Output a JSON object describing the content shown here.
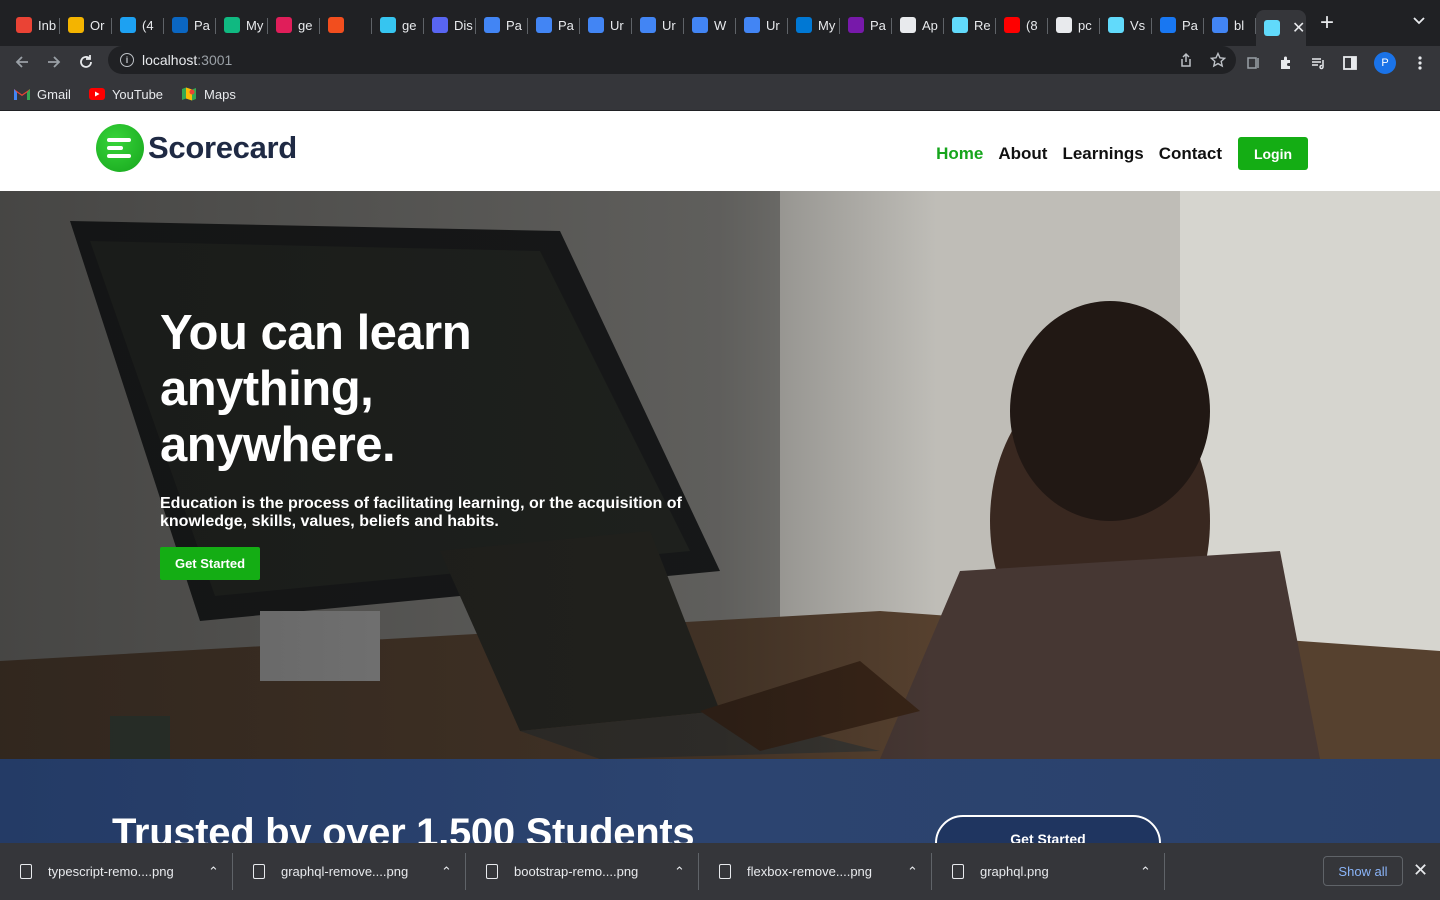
{
  "browser": {
    "tabs": [
      {
        "label": "Inb",
        "icon": "gmail-icon",
        "color": "#ea4335"
      },
      {
        "label": "Or",
        "icon": "pinwheel-icon",
        "color": "#f4b400"
      },
      {
        "label": "(4",
        "icon": "twitter-icon",
        "color": "#1da1f2"
      },
      {
        "label": "Pa",
        "icon": "linkedin-icon",
        "color": "#0a66c2"
      },
      {
        "label": "My",
        "icon": "globe-icon",
        "color": "#10b981"
      },
      {
        "label": "ge",
        "icon": "slack-icon",
        "color": "#e01e5a"
      },
      {
        "label": "",
        "icon": "figma-icon",
        "color": "#f24e1e"
      },
      {
        "label": "ge",
        "icon": "slack-icon",
        "color": "#36c5f0"
      },
      {
        "label": "Dis",
        "icon": "discord-icon",
        "color": "#5865f2"
      },
      {
        "label": "Pa",
        "icon": "docs-icon",
        "color": "#4285f4"
      },
      {
        "label": "Pa",
        "icon": "docs-icon",
        "color": "#4285f4"
      },
      {
        "label": "Ur",
        "icon": "docs-icon",
        "color": "#4285f4"
      },
      {
        "label": "Ur",
        "icon": "docs-icon",
        "color": "#4285f4"
      },
      {
        "label": "W",
        "icon": "docs-icon",
        "color": "#4285f4"
      },
      {
        "label": "Ur",
        "icon": "docs-icon",
        "color": "#4285f4"
      },
      {
        "label": "My",
        "icon": "azure-devops-icon",
        "color": "#0078d4"
      },
      {
        "label": "Pa",
        "icon": "onenote-icon",
        "color": "#7719aa"
      },
      {
        "label": "Ap",
        "icon": "zeplin-icon",
        "color": "#e8eaed"
      },
      {
        "label": "Re",
        "icon": "react-icon",
        "color": "#61dafb"
      },
      {
        "label": "(8",
        "icon": "youtube-icon",
        "color": "#ff0000"
      },
      {
        "label": "pc",
        "icon": "github-icon",
        "color": "#e8eaed"
      },
      {
        "label": "Vs",
        "icon": "react-icon",
        "color": "#61dafb"
      },
      {
        "label": "Pa",
        "icon": "facebook-icon",
        "color": "#1877f2"
      },
      {
        "label": "bl",
        "icon": "google-icon",
        "color": "#4285f4"
      }
    ],
    "active_tab": {
      "icon": "react-icon",
      "color": "#61dafb"
    },
    "url_host": "localhost",
    "url_port": ":3001",
    "profile_initial": "P",
    "bookmarks": [
      {
        "label": "Gmail",
        "icon": "gmail-icon"
      },
      {
        "label": "YouTube",
        "icon": "youtube-icon"
      },
      {
        "label": "Maps",
        "icon": "maps-icon"
      }
    ]
  },
  "site": {
    "brand": "Scorecard",
    "nav": {
      "home": "Home",
      "about": "About",
      "learnings": "Learnings",
      "contact": "Contact",
      "login": "Login"
    },
    "hero": {
      "title": "You can learn anything, anywhere.",
      "subtitle": "Education is the process of facilitating learning, or the acquisition of knowledge, skills, values, beliefs and habits.",
      "cta": "Get Started"
    },
    "trusted": {
      "title": "Trusted by over 1,500 Students",
      "cta": "Get Started"
    },
    "colors": {
      "accent": "#14ad14",
      "brand_dark": "#1f2a44",
      "band": "#243b66"
    }
  },
  "downloads": {
    "items": [
      {
        "name": "typescript-remo....png"
      },
      {
        "name": "graphql-remove....png"
      },
      {
        "name": "bootstrap-remo....png"
      },
      {
        "name": "flexbox-remove....png"
      },
      {
        "name": "graphql.png"
      }
    ],
    "show_all": "Show all"
  }
}
